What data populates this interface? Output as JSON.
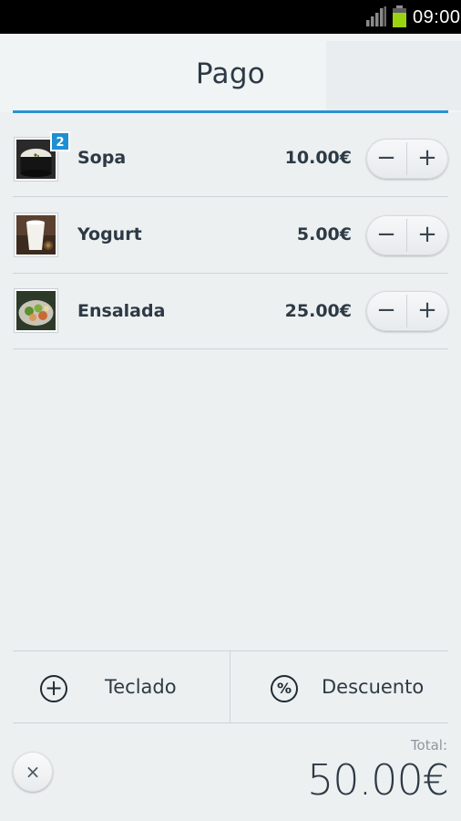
{
  "status_bar": {
    "time": "09:00",
    "signal_icon": "signal-icon",
    "battery_icon": "battery-icon"
  },
  "header": {
    "title": "Pago"
  },
  "items": [
    {
      "name": "Sopa",
      "price": "10.00€",
      "quantity_badge": "2",
      "thumb_icon": "soup-image"
    },
    {
      "name": "Yogurt",
      "price": "5.00€",
      "thumb_icon": "yogurt-image"
    },
    {
      "name": "Ensalada",
      "price": "25.00€",
      "thumb_icon": "salad-image"
    }
  ],
  "stepper": {
    "minus": "−",
    "plus": "+"
  },
  "actions": {
    "keypad_label": "Teclado",
    "keypad_icon": "+",
    "discount_label": "Descuento",
    "discount_icon": "%"
  },
  "footer": {
    "clear": "×",
    "total_label": "Total:",
    "total_value": "50.00€"
  },
  "colors": {
    "accent": "#2a93d3",
    "badge": "#1f8fd3",
    "text": "#2d3a45",
    "background": "#edf0f1"
  }
}
